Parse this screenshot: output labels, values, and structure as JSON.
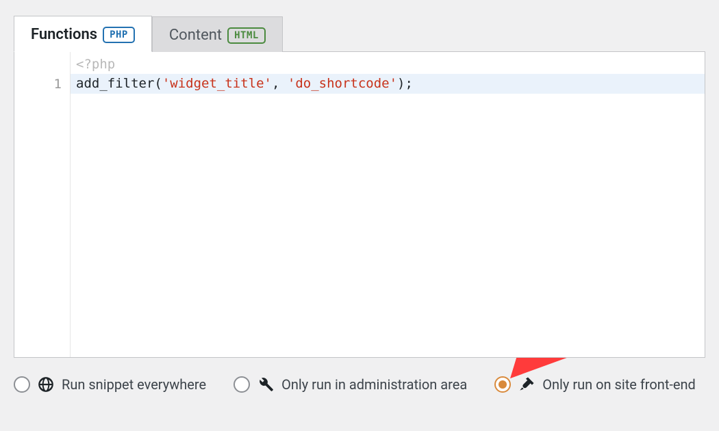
{
  "tabs": [
    {
      "label": "Functions",
      "badge": "PHP",
      "active": true
    },
    {
      "label": "Content",
      "badge": "HTML",
      "active": false
    }
  ],
  "editor": {
    "opening_tag": "<?php",
    "line_number": "1",
    "code": {
      "func": "add_filter",
      "open": "(",
      "arg1": "'widget_title'",
      "comma": ", ",
      "arg2": "'do_shortcode'",
      "close": ");"
    }
  },
  "run_options": [
    {
      "key": "everywhere",
      "label": "Run snippet everywhere",
      "checked": false,
      "icon": "globe"
    },
    {
      "key": "admin",
      "label": "Only run in administration area",
      "checked": false,
      "icon": "wrench"
    },
    {
      "key": "frontend",
      "label": "Only run on site front-end",
      "checked": true,
      "icon": "hammer-brush"
    }
  ]
}
